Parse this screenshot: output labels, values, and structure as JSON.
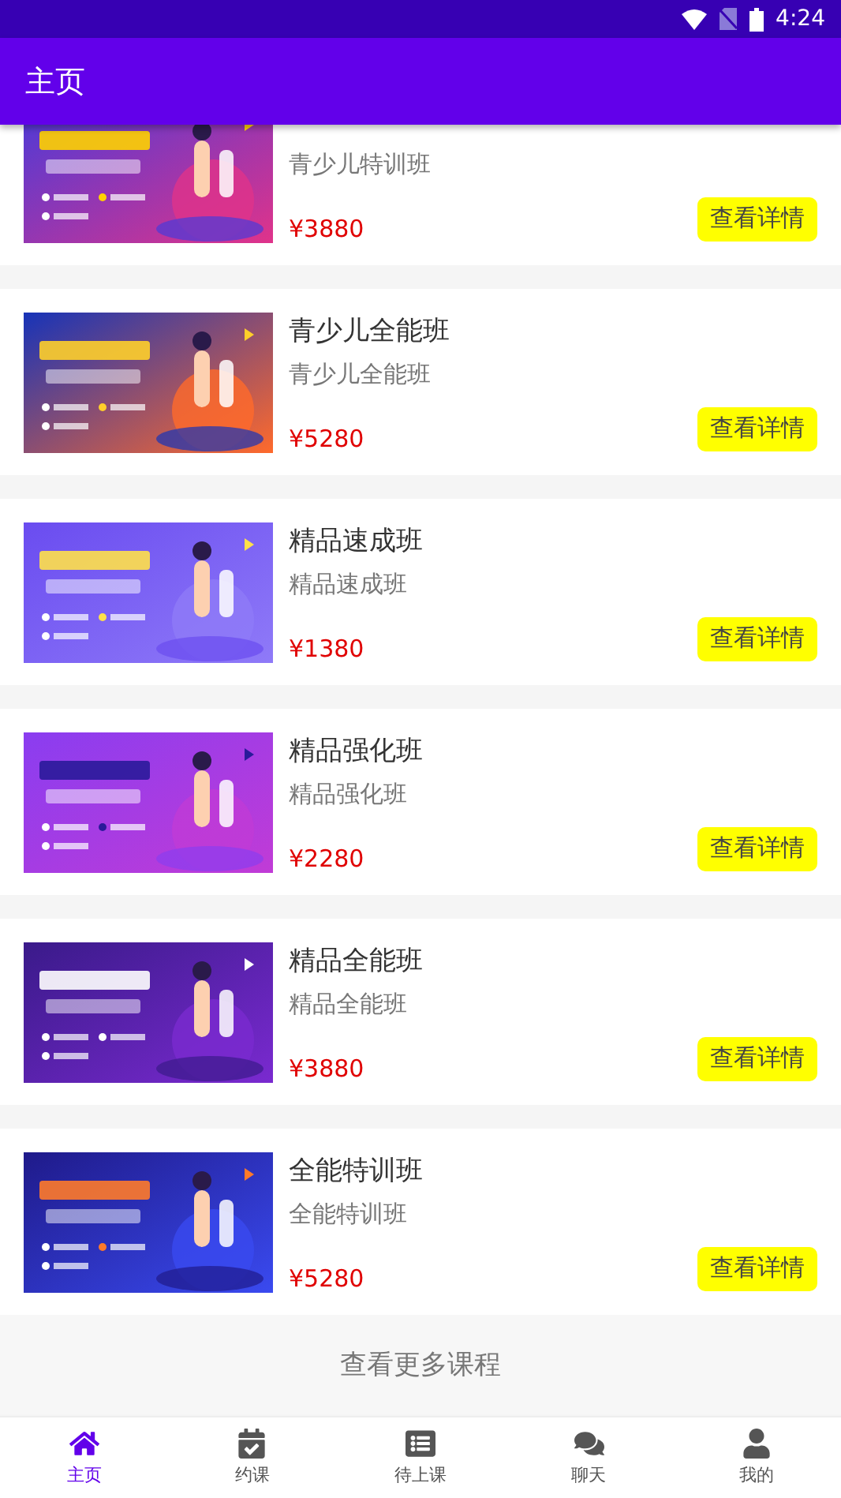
{
  "status_bar": {
    "time": "4:24"
  },
  "app_bar": {
    "title": "主页"
  },
  "courses": [
    {
      "subtitle": "青少儿特训班",
      "price": "¥3880",
      "button": "查看详情"
    },
    {
      "title": "青少儿全能班",
      "subtitle": "青少儿全能班",
      "price": "¥5280",
      "button": "查看详情"
    },
    {
      "title": "精品速成班",
      "subtitle": "精品速成班",
      "price": "¥1380",
      "button": "查看详情"
    },
    {
      "title": "精品强化班",
      "subtitle": "精品强化班",
      "price": "¥2280",
      "button": "查看详情"
    },
    {
      "title": "精品全能班",
      "subtitle": "精品全能班",
      "price": "¥3880",
      "button": "查看详情"
    },
    {
      "title": "全能特训班",
      "subtitle": "全能特训班",
      "price": "¥5280",
      "button": "查看详情"
    }
  ],
  "more_button": "查看更多课程",
  "bottom_nav": [
    {
      "kind": "home",
      "label": "主页",
      "selected": true
    },
    {
      "kind": "calendar",
      "label": "约课",
      "selected": false
    },
    {
      "kind": "list",
      "label": "待上课",
      "selected": false
    },
    {
      "kind": "chat",
      "label": "聊天",
      "selected": false
    },
    {
      "kind": "user",
      "label": "我的",
      "selected": false
    }
  ]
}
